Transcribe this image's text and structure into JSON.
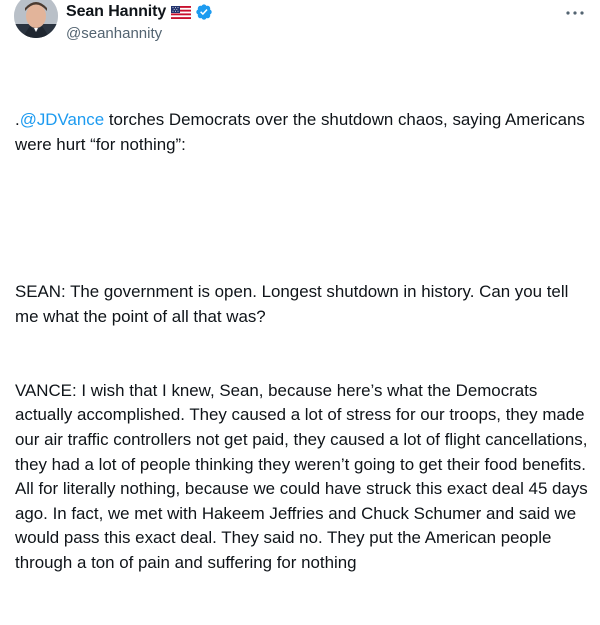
{
  "author": {
    "display_name": "Sean Hannity",
    "handle": "@seanhannity",
    "flag_icon": "us-flag-icon",
    "verified_icon": "verified-badge-icon",
    "verified_color": "#1d9bf0"
  },
  "more_icon": "more-horizontal-icon",
  "tweet": {
    "intro_prefix": ".",
    "mention": "@JDVance",
    "intro_rest": " torches Democrats over the shutdown chaos, saying Americans were hurt “for nothing”:",
    "sean_line": "SEAN: The government is open. Longest shutdown in history. Can you tell me what the point of all that was?",
    "vance_line": "VANCE: I wish that I knew, Sean, because here’s what the Democrats actually accomplished. They caused a lot of stress for our troops, they made our air traffic controllers not get paid, they caused a lot of flight cancellations, they had a lot of people thinking they weren’t going to get their food benefits. All for literally nothing, because we could have struck this exact deal 45 days ago. In fact, we met with Hakeem Jeffries and Chuck Schumer and said we would pass this exact deal. They said no. They put the American people through a ton of pain and suffering for nothing"
  }
}
